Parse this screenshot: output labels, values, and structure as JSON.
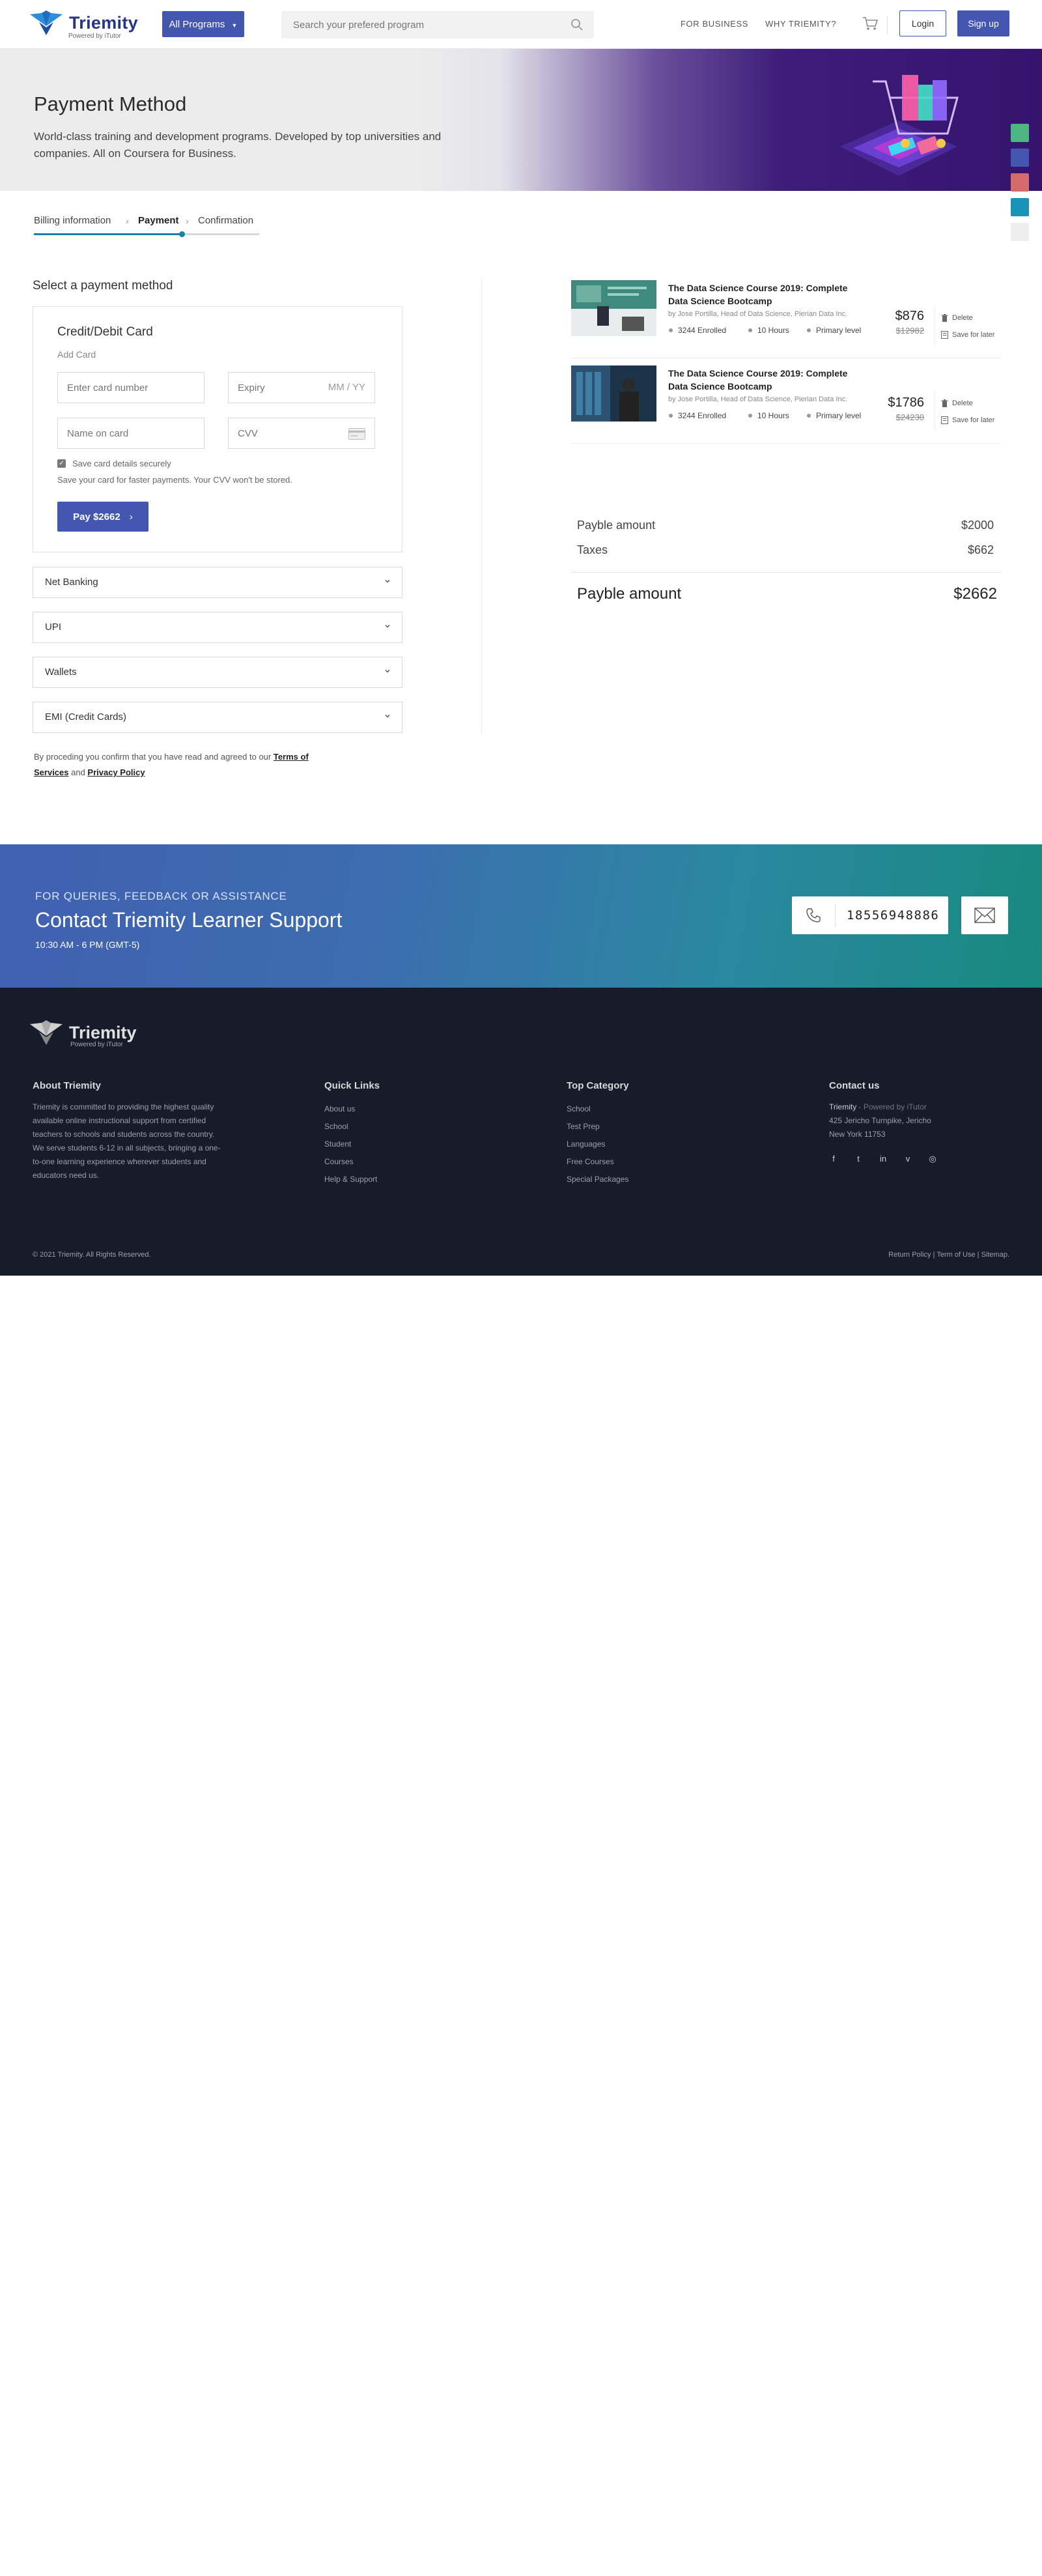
{
  "header": {
    "logo_title": "Triemity",
    "logo_sub": "Powered by iTutor",
    "programs_label": "All Programs",
    "search_placeholder": "Search your prefered program",
    "nav_business": "FOR BUSINESS",
    "nav_why": "WHY TRIEMITY?",
    "login": "Login",
    "signup": "Sign up"
  },
  "hero": {
    "title": "Payment Method",
    "subtitle": "World-class training and development programs. Developed by top universities and companies. All on Coursera for Business."
  },
  "swatches": [
    "#4cb582",
    "#4356b0",
    "#d56a6a",
    "#1993b7",
    "#eeeeee"
  ],
  "steps": {
    "items": [
      "Billing information",
      "Payment",
      "Confirmation"
    ],
    "active": 1,
    "progress": 0.656
  },
  "payment": {
    "section_title": "Select a payment method",
    "card_title": "Credit/Debit Card",
    "card_sub": "Add Card",
    "card_number_placeholder": "Enter card number",
    "expiry_placeholder": "Expiry",
    "expiry_format": "MM / YY",
    "name_placeholder": "Name on card",
    "cvv_placeholder": "CVV",
    "save_checkbox_label": "Save card details securely",
    "save_note": "Save your card for faster payments. Your CVV won't be stored.",
    "pay_label": "Pay $2662",
    "methods": [
      "Net Banking",
      "UPI",
      "Wallets",
      "EMI (Credit Cards)"
    ],
    "terms_prefix": "By proceding you confirm that you have read and agreed to our ",
    "terms_link": "Terms of Services",
    "terms_and": " and ",
    "privacy_link": "Privacy Policy"
  },
  "cart": {
    "items": [
      {
        "title": "The Data Science Course 2019: Complete Data Science Bootcamp",
        "author": "by Jose Portilla, Head of Data Science, Pierian Data Inc.",
        "enrolled": "3244 Enrolled",
        "hours": "10 Hours",
        "level": "Primary level",
        "price": "$876",
        "old_price": "$12982",
        "delete": "Delete",
        "save_later": "Save for later"
      },
      {
        "title": "The Data Science Course 2019: Complete Data Science Bootcamp",
        "author": "by Jose Portilla, Head of Data Science, Pierian Data Inc.",
        "enrolled": "3244 Enrolled",
        "hours": "10 Hours",
        "level": "Primary level",
        "price": "$1786",
        "old_price": "$24230",
        "delete": "Delete",
        "save_later": "Save for later"
      }
    ]
  },
  "summary": {
    "payable_label": "Payble amount",
    "payable_value": "$2000",
    "taxes_label": "Taxes",
    "taxes_value": "$662",
    "total_label": "Payble amount",
    "total_value": "$2662"
  },
  "support": {
    "kicker": "FOR QUERIES, FEEDBACK OR ASSISTANCE",
    "title": "Contact Triemity Learner Support",
    "hours": "10:30 AM - 6 PM (GMT-5)",
    "phone": "18556948886"
  },
  "footer": {
    "logo_title": "Triemity",
    "logo_sub": "Powered by iTutor",
    "about_head": "About Triemity",
    "about_text": "Triemity is committed to providing the highest quality available online instructional support from certified teachers to schools and students across the country. We serve students 6-12 in all subjects, bringing a one-to-one learning experience wherever students and educators need us.",
    "quick_head": "Quick Links",
    "quick_links": [
      "About us",
      "School",
      "Student",
      "Courses",
      "Help & Support"
    ],
    "top_head": "Top Category",
    "top_links": [
      "School",
      "Test Prep",
      "Languages",
      "Free Courses",
      "Special Packages"
    ],
    "contact_head": "Contact us",
    "contact_name": "Triemity",
    "contact_powered": " - Powered by iTutor",
    "contact_addr1": "425 Jericho Turnpike, Jericho",
    "contact_addr2": "New York 11753",
    "copyright": "© 2021 Triemity. All Rights Reserved.",
    "bottom_links": "Return Policy | Term of Use | Sitemap."
  }
}
